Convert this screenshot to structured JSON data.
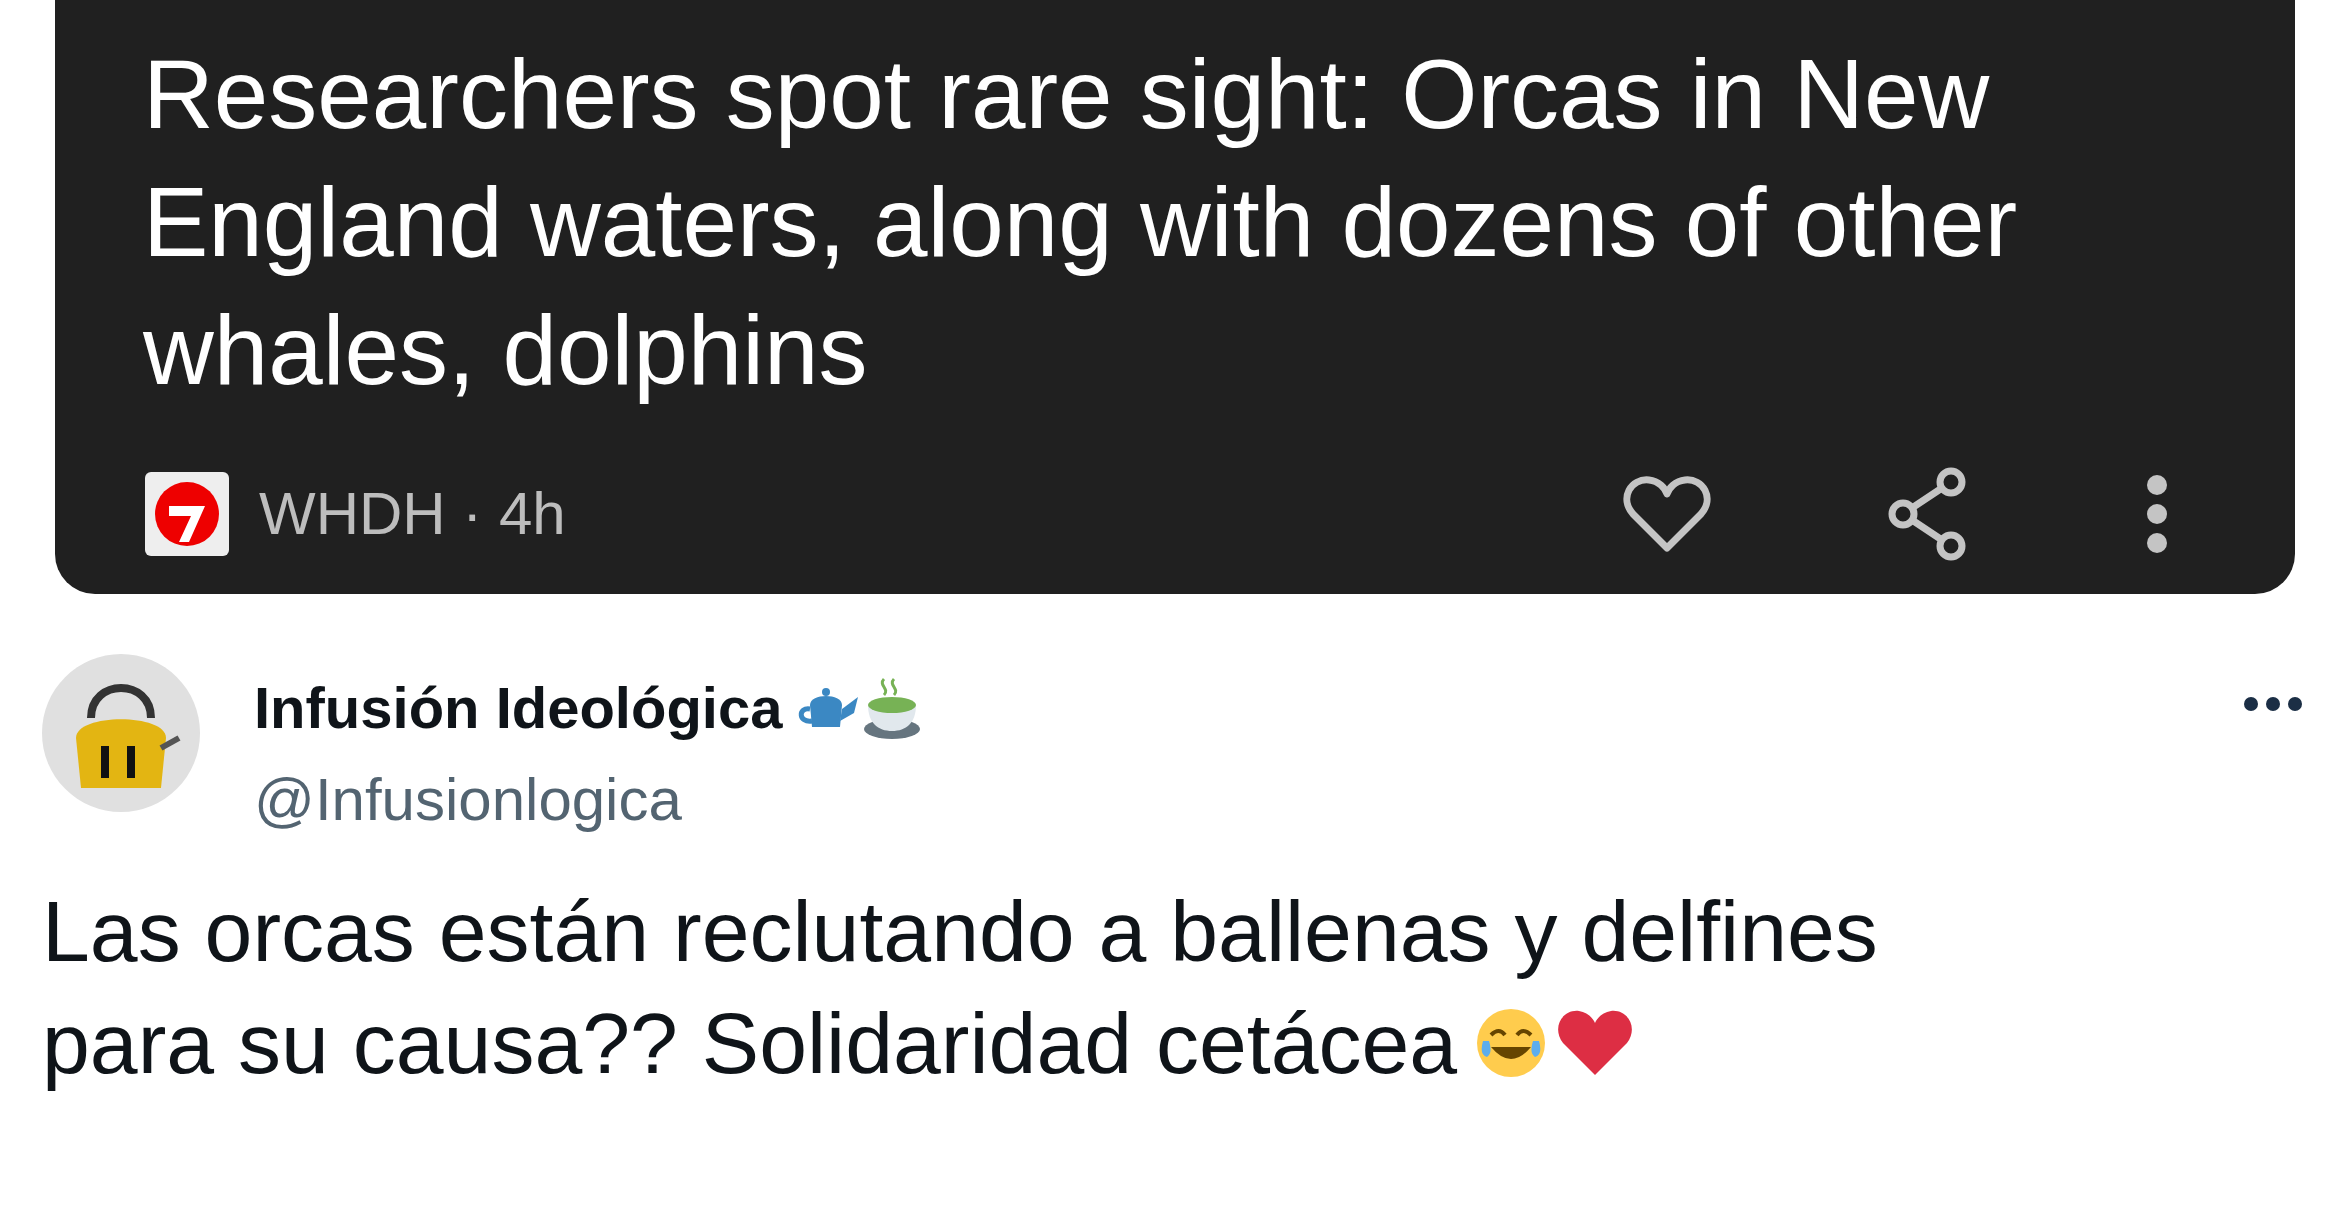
{
  "news_card": {
    "headline": "Researchers spot rare sight: Orcas in New England waters, along with dozens of other whales, dolphins",
    "source_line": "WHDH · 4h"
  },
  "tweet": {
    "display_name": "Infusión Ideológica",
    "handle": "@Infusionlogica",
    "text_lines": [
      "Las orcas están reclutando a ballenas y delfines",
      "para su causa?? Solidaridad cetácea"
    ]
  }
}
